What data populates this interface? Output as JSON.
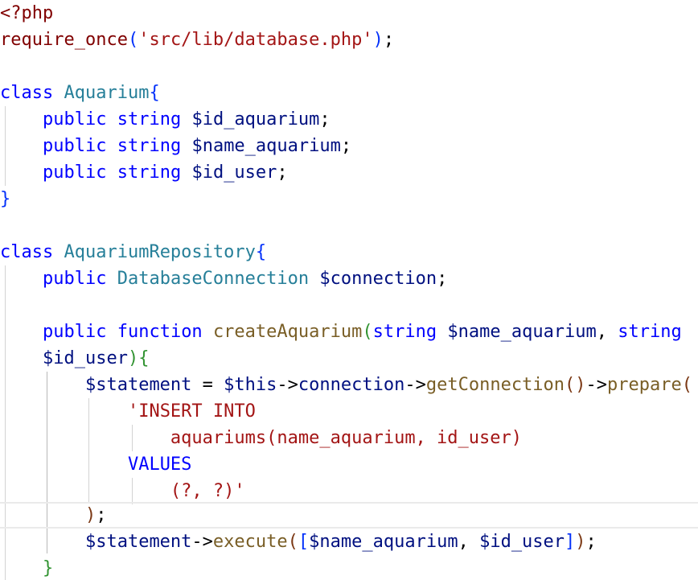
{
  "code": {
    "open_tag": "<?php",
    "require_fn": "require_once",
    "require_path": "'src/lib/database.php'",
    "kw_class": "class",
    "kw_public": "public",
    "kw_function": "function",
    "type_string": "string",
    "class_aquarium": "Aquarium",
    "prop_id_aquarium": "$id_aquarium",
    "prop_name_aquarium": "$name_aquarium",
    "prop_id_user": "$id_user",
    "class_repo": "AquariumRepository",
    "type_db_conn": "DatabaseConnection",
    "prop_connection": "$connection",
    "method_create": "createAquarium",
    "param_name_aquarium": "$name_aquarium",
    "param_id_user": "$id_user",
    "var_statement": "$statement",
    "var_this": "$this",
    "member_connection": "connection",
    "method_get_conn": "getConnection",
    "method_prepare": "prepare",
    "sql_insert": "'INSERT INTO",
    "sql_table": "aquariums(name_aquarium, id_user)",
    "sql_values": "VALUES",
    "sql_placeholders": "(?, ?)'",
    "method_execute": "execute",
    "arg_name_aquarium": "$name_aquarium",
    "arg_id_user": "$id_user"
  }
}
